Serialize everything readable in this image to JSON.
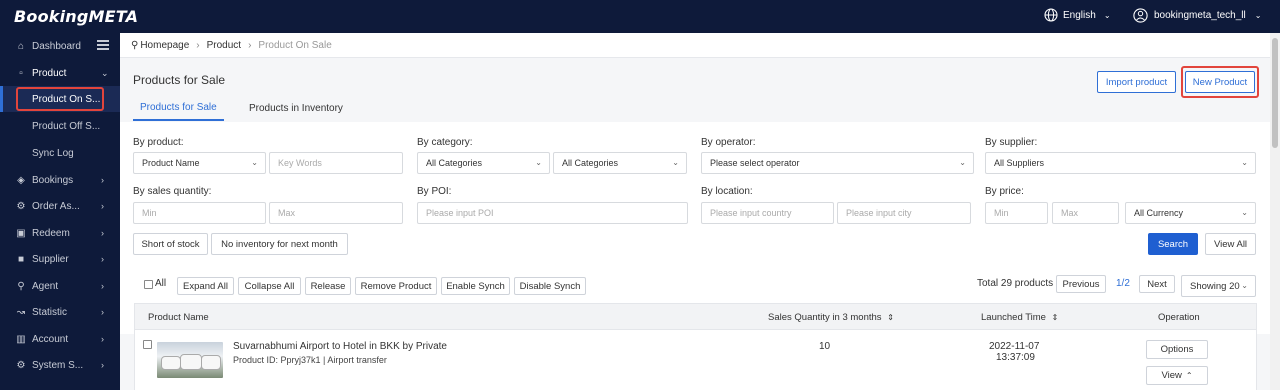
{
  "app": {
    "logo": "BookingMETA"
  },
  "topbar": {
    "language": "English",
    "user": "bookingmeta_tech_ll"
  },
  "sidebar": {
    "items": [
      {
        "label": "Dashboard",
        "icon": "home-icon"
      },
      {
        "label": "Product",
        "icon": "box-icon"
      },
      {
        "label": "Bookings",
        "icon": "bookings-icon"
      },
      {
        "label": "Order As...",
        "icon": "order-icon"
      },
      {
        "label": "Redeem",
        "icon": "redeem-icon"
      },
      {
        "label": "Supplier",
        "icon": "supplier-icon"
      },
      {
        "label": "Agent",
        "icon": "agent-icon"
      },
      {
        "label": "Statistic",
        "icon": "statistic-icon"
      },
      {
        "label": "Account",
        "icon": "account-icon"
      },
      {
        "label": "System S...",
        "icon": "system-icon"
      }
    ],
    "product_sub": [
      "Product On S...",
      "Product Off S...",
      "Sync Log"
    ]
  },
  "breadcrumb": {
    "home": "Homepage",
    "level1": "Product",
    "current": "Product On Sale"
  },
  "page": {
    "title": "Products for Sale",
    "import_button": "Import product",
    "new_button": "New Product",
    "tabs": [
      "Products for Sale",
      "Products in Inventory"
    ]
  },
  "filters": {
    "by_product": "By product:",
    "product_select": "Product Name",
    "keywords_placeholder": "Key Words",
    "by_category": "By category:",
    "category1": "All Categories",
    "category2": "All Categories",
    "by_operator": "By operator:",
    "operator_placeholder": "Please select operator",
    "by_supplier": "By supplier:",
    "supplier_select": "All Suppliers",
    "by_sales_quantity": "By sales quantity:",
    "min_placeholder": "Min",
    "max_placeholder": "Max",
    "by_poi": "By POI:",
    "poi_placeholder": "Please input POI",
    "by_location": "By location:",
    "country_placeholder": "Please input country",
    "city_placeholder": "Please input city",
    "by_price": "By price:",
    "price_min_placeholder": "Min",
    "price_max_placeholder": "Max",
    "currency_select": "All Currency",
    "short_of_stock": "Short of stock",
    "no_inventory": "No inventory for next month",
    "search": "Search",
    "view_all": "View All"
  },
  "toolbar": {
    "all": "All",
    "expand_all": "Expand All",
    "collapse_all": "Collapse All",
    "release": "Release",
    "remove_product": "Remove Product",
    "enable_synch": "Enable Synch",
    "disable_synch": "Disable Synch",
    "total": "Total 29 products",
    "previous": "Previous",
    "page": "1/2",
    "next": "Next",
    "showing": "Showing 20"
  },
  "table": {
    "headers": [
      "Product Name",
      "Sales Quantity in 3 months",
      "Launched Time",
      "Operation"
    ],
    "rows": [
      {
        "name": "Suvarnabhumi Airport to Hotel in BKK by Private",
        "meta": "Product ID:  Ppryj37k1 | Airport transfer",
        "sales": "10",
        "date": "2022-11-07",
        "time": "13:37:09",
        "options": "Options",
        "view": "View"
      }
    ]
  },
  "colors": {
    "nav_bg": "#0e1a3a",
    "accent": "#2f6fd6",
    "highlight": "#e2453c"
  }
}
